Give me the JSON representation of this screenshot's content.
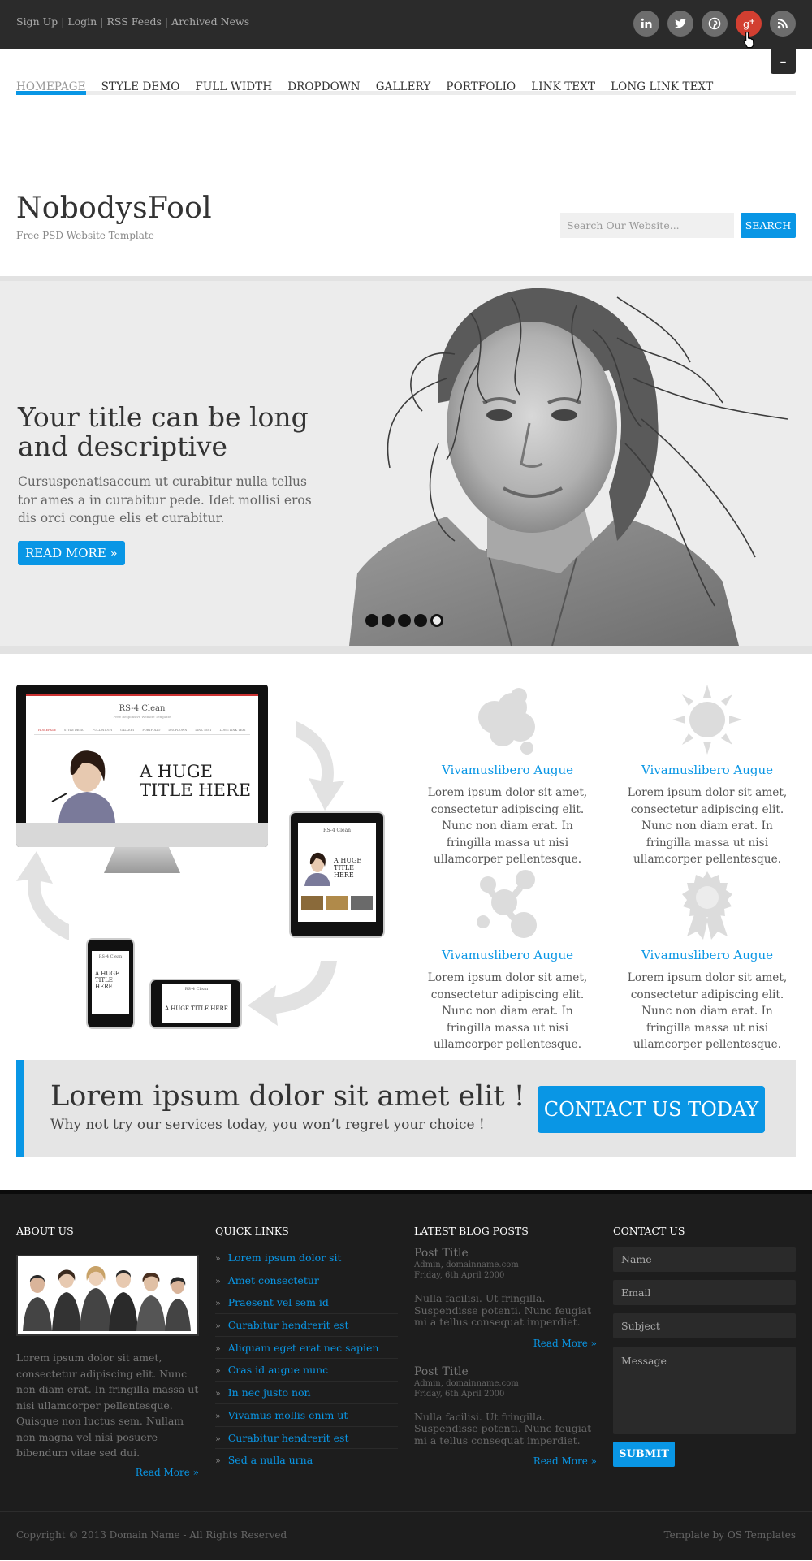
{
  "topbar": {
    "links": [
      "Sign Up",
      "Login",
      "RSS Feeds",
      "Archived News"
    ],
    "social": [
      "linkedin-icon",
      "twitter-icon",
      "pinterest-icon",
      "googleplus-icon",
      "rss-icon"
    ],
    "active_social": "googleplus-icon",
    "menu_toggle": "–"
  },
  "nav": {
    "items": [
      "HOMEPAGE",
      "STYLE DEMO",
      "FULL WIDTH",
      "DROPDOWN",
      "GALLERY",
      "PORTFOLIO",
      "LINK TEXT",
      "LONG LINK TEXT"
    ],
    "active": "HOMEPAGE"
  },
  "header": {
    "site_name": "NobodysFool",
    "tagline": "Free PSD Website Template",
    "search_placeholder": "Search Our Website...",
    "search_button": "SEARCH"
  },
  "slider": {
    "title": "Your title can be long and descriptive",
    "text": "Cursuspenatisaccum ut curabitur nulla tellus tor ames a in curabitur pede. Idet mollisi eros dis orci congue elis et curabitur.",
    "button": "READ MORE »",
    "dots_count": 5,
    "active_dot": 5
  },
  "devices": {
    "monitor_brand": "RS-4 Clean",
    "monitor_subtitle": "Free Responsive Website Template",
    "monitor_menu": [
      "HOMEPAGE",
      "STYLE DEMO",
      "FULL WIDTH",
      "GALLERY",
      "PORTFOLIO",
      "DROPDOWN",
      "LINK TEXT",
      "LONG LINK TEXT"
    ],
    "headline": "A HUGE TITLE HERE"
  },
  "services": [
    {
      "icon": "cloud-icon",
      "title": "Vivamuslibero Augue",
      "text": "Lorem ipsum dolor sit amet, consectetur adipiscing elit. Nunc non diam erat. In fringilla massa ut nisi ullamcorper pellentesque."
    },
    {
      "icon": "sun-icon",
      "title": "Vivamuslibero Augue",
      "text": "Lorem ipsum dolor sit amet, consectetur adipiscing elit. Nunc non diam erat. In fringilla massa ut nisi ullamcorper pellentesque."
    },
    {
      "icon": "molecule-icon",
      "title": "Vivamuslibero Augue",
      "text": "Lorem ipsum dolor sit amet, consectetur adipiscing elit. Nunc non diam erat. In fringilla massa ut nisi ullamcorper pellentesque."
    },
    {
      "icon": "award-icon",
      "title": "Vivamuslibero Augue",
      "text": "Lorem ipsum dolor sit amet, consectetur adipiscing elit. Nunc non diam erat. In fringilla massa ut nisi ullamcorper pellentesque."
    }
  ],
  "cta": {
    "title": "Lorem ipsum dolor sit amet elit !",
    "subtitle": "Why not try our services today, you won’t regret your choice !",
    "button": "CONTACT US TODAY"
  },
  "footer": {
    "about": {
      "heading": "ABOUT US",
      "text": "Lorem ipsum dolor sit amet, consectetur adipiscing elit. Nunc non diam erat. In fringilla massa ut nisi ullamcorper pellentesque. Quisque non luctus sem. Nullam non magna vel nisi posuere bibendum vitae sed dui.",
      "read_more": "Read More »"
    },
    "quicklinks": {
      "heading": "QUICK LINKS",
      "items": [
        "Lorem ipsum dolor sit",
        "Amet consectetur",
        "Praesent vel sem id",
        "Curabitur hendrerit est",
        "Aliquam eget erat nec sapien",
        "Cras id augue nunc",
        "In nec justo non",
        "Vivamus mollis enim ut",
        "Curabitur hendrerit est",
        "Sed a nulla urna"
      ]
    },
    "blog": {
      "heading": "LATEST BLOG POSTS",
      "posts": [
        {
          "title": "Post Title",
          "author": "Admin, domainname.com",
          "date": "Friday, 6th April 2000",
          "body": "Nulla facilisi. Ut fringilla. Suspendisse potenti. Nunc feugiat mi a tellus consequat imperdiet.",
          "read_more": "Read More »"
        },
        {
          "title": "Post Title",
          "author": "Admin, domainname.com",
          "date": "Friday, 6th April 2000",
          "body": "Nulla facilisi. Ut fringilla. Suspendisse potenti. Nunc feugiat mi a tellus consequat imperdiet.",
          "read_more": "Read More »"
        }
      ]
    },
    "contact": {
      "heading": "CONTACT US",
      "name_placeholder": "Name",
      "email_placeholder": "Email",
      "subject_placeholder": "Subject",
      "message_placeholder": "Message",
      "submit": "SUBMIT"
    }
  },
  "copyright": {
    "left": "Copyright © 2013 Domain Name - All Rights Reserved",
    "right": "Template by OS Templates"
  },
  "colors": {
    "accent": "#0996e5",
    "topbar": "#2b2b2b",
    "footer": "#1d1d1d",
    "googleplus": "#d23f31"
  }
}
